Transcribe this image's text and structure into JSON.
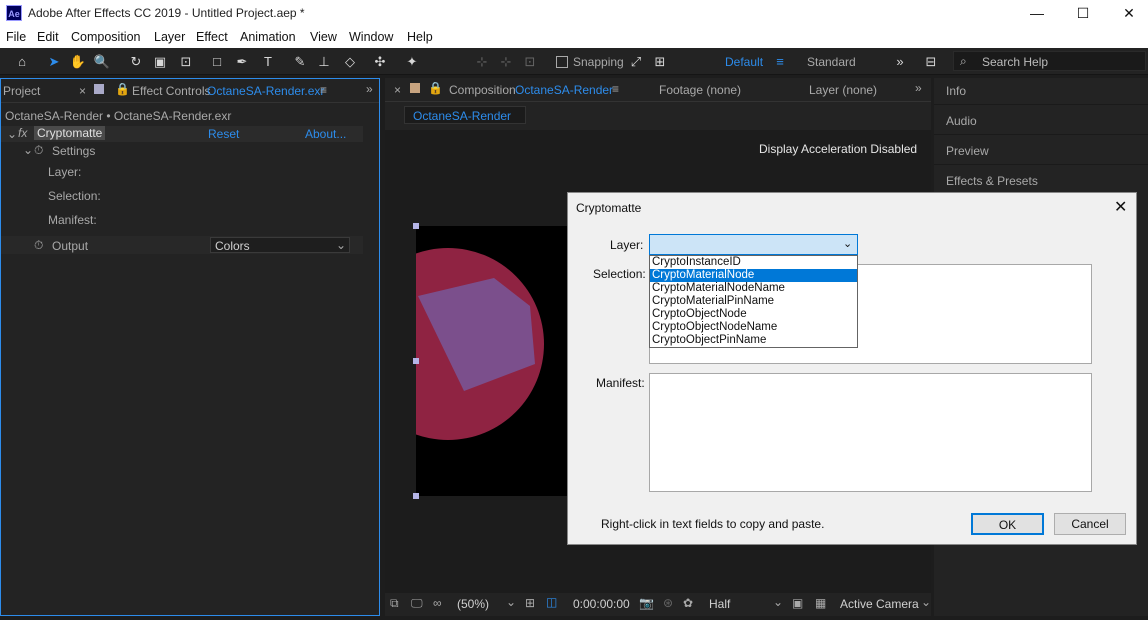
{
  "window": {
    "app_icon": "Ae",
    "title": "Adobe After Effects CC 2019 - Untitled Project.aep *",
    "minimize": "—",
    "maximize": "☐",
    "close": "✕"
  },
  "menu": [
    "File",
    "Edit",
    "Composition",
    "Layer",
    "Effect",
    "Animation",
    "View",
    "Window",
    "Help"
  ],
  "toolbar": {
    "snapping": "Snapping",
    "workspace_default": "Default",
    "workspace_standard": "Standard",
    "search_placeholder": "Search Help"
  },
  "left_panel": {
    "tab_project": "Project",
    "tab_effect_controls": "Effect Controls",
    "tab_effect_controls_file": "OctaneSA-Render.exr",
    "breadcrumb": "OctaneSA-Render • OctaneSA-Render.exr",
    "effect_name": "Cryptomatte",
    "reset": "Reset",
    "about": "About...",
    "settings": "Settings",
    "layer_label": "Layer:",
    "selection_label": "Selection:",
    "manifest_label": "Manifest:",
    "output_label": "Output",
    "output_value": "Colors"
  },
  "comp_panel": {
    "tab_composition": "Composition",
    "tab_composition_name": "OctaneSA-Render",
    "tab_footage": "Footage (none)",
    "tab_layer": "Layer (none)",
    "comp_tab": "OctaneSA-Render",
    "display_msg": "Display Acceleration Disabled",
    "zoom": "(50%)",
    "timecode": "0:00:00:00",
    "resolution": "Half",
    "camera": "Active Camera"
  },
  "right_panel": {
    "items": [
      "Info",
      "Audio",
      "Preview",
      "Effects & Presets"
    ]
  },
  "dialog": {
    "title": "Cryptomatte",
    "layer_label": "Layer:",
    "selection_label": "Selection:",
    "manifest_label": "Manifest:",
    "hint": "Right-click in text fields to copy and paste.",
    "ok": "OK",
    "cancel": "Cancel",
    "layer_options": [
      "CryptoInstanceID",
      "CryptoMaterialNode",
      "CryptoMaterialNodeName",
      "CryptoMaterialPinName",
      "CryptoObjectNode",
      "CryptoObjectNodeName",
      "CryptoObjectPinName"
    ],
    "highlighted_option": "CryptoMaterialNode"
  },
  "colors": {
    "accent": "#2d8ceb",
    "selection_blue": "#0078d7",
    "sphere": "#a8294e",
    "patch": "#7a5290"
  }
}
